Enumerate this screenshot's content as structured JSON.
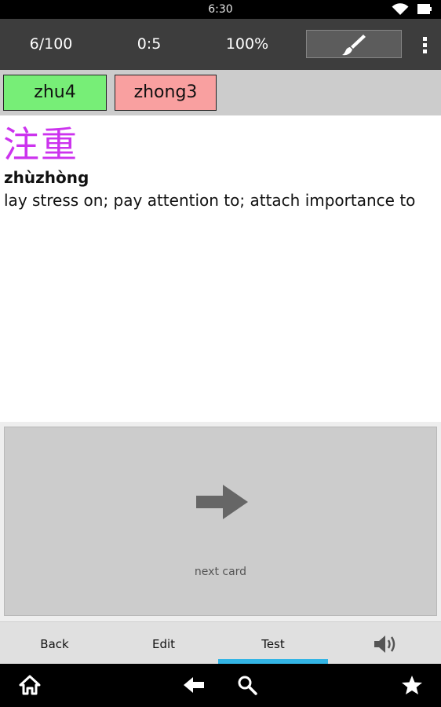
{
  "status_bar": {
    "time": "6:30"
  },
  "toolbar": {
    "progress": "6/100",
    "timer": "0:5",
    "score": "100%",
    "brush_icon": "paintbrush-icon",
    "overflow_icon": "overflow-menu-icon"
  },
  "tones": [
    {
      "label": "zhu4",
      "color": "#77ee77"
    },
    {
      "label": "zhong3",
      "color": "#f9a0a0"
    }
  ],
  "card": {
    "hanzi": "注重",
    "pinyin": "zhùzhòng",
    "definition": "lay stress on; pay attention to; attach importance to",
    "hanzi_color": "#cc33ee"
  },
  "next_card": {
    "label": "next card",
    "icon": "arrow-right-icon"
  },
  "tabs": [
    {
      "label": "Back"
    },
    {
      "label": "Edit"
    },
    {
      "label": "Test",
      "active": true
    },
    {
      "label": "",
      "icon": "speaker-icon"
    }
  ],
  "accent_color": "#33b5e5",
  "nav": [
    "home-icon",
    "back-icon",
    "search-icon",
    "star-icon"
  ]
}
